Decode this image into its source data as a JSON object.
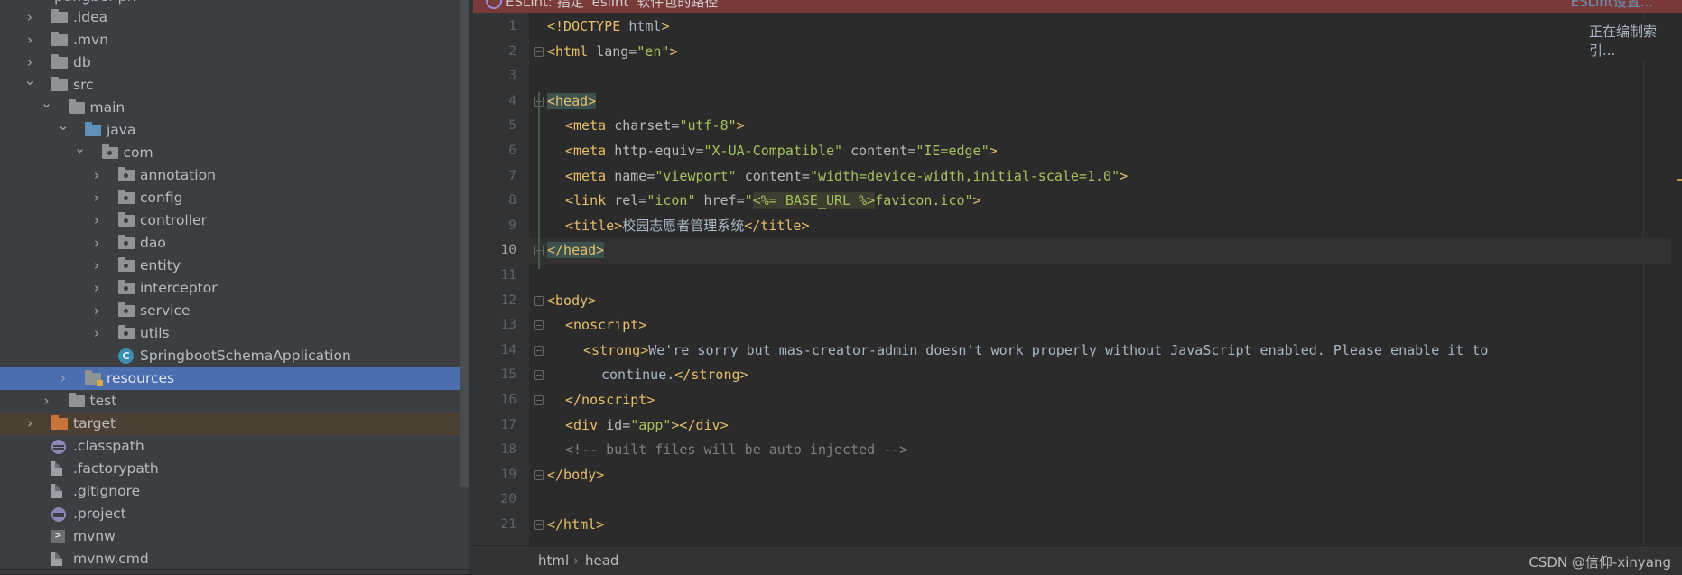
{
  "tree": {
    "top_clip": "pangbei-ph",
    "items": [
      {
        "label": ".idea",
        "depth": 1,
        "icon": "folder-icon",
        "expanded": false
      },
      {
        "label": ".mvn",
        "depth": 1,
        "icon": "folder-icon",
        "expanded": false
      },
      {
        "label": "db",
        "depth": 1,
        "icon": "folder-icon",
        "expanded": false
      },
      {
        "label": "src",
        "depth": 1,
        "icon": "folder-icon",
        "expanded": true
      },
      {
        "label": "main",
        "depth": 2,
        "icon": "folder-icon",
        "expanded": true
      },
      {
        "label": "java",
        "depth": 3,
        "icon": "source-folder-icon",
        "expanded": true
      },
      {
        "label": "com",
        "depth": 4,
        "icon": "package-icon",
        "expanded": true
      },
      {
        "label": "annotation",
        "depth": 5,
        "icon": "package-icon",
        "expanded": false
      },
      {
        "label": "config",
        "depth": 5,
        "icon": "package-icon",
        "expanded": false
      },
      {
        "label": "controller",
        "depth": 5,
        "icon": "package-icon",
        "expanded": false
      },
      {
        "label": "dao",
        "depth": 5,
        "icon": "package-icon",
        "expanded": false
      },
      {
        "label": "entity",
        "depth": 5,
        "icon": "package-icon",
        "expanded": false
      },
      {
        "label": "interceptor",
        "depth": 5,
        "icon": "package-icon",
        "expanded": false
      },
      {
        "label": "service",
        "depth": 5,
        "icon": "package-icon",
        "expanded": false
      },
      {
        "label": "utils",
        "depth": 5,
        "icon": "package-icon",
        "expanded": false
      },
      {
        "label": "SpringbootSchemaApplication",
        "depth": 5,
        "icon": "java-class-icon",
        "leaf": true
      },
      {
        "label": "resources",
        "depth": 3,
        "icon": "resources-folder-icon",
        "expanded": false,
        "selected": true
      },
      {
        "label": "test",
        "depth": 2,
        "icon": "folder-icon",
        "expanded": false
      },
      {
        "label": "target",
        "depth": 1,
        "icon": "excluded-folder-icon",
        "expanded": false,
        "excluded": true
      },
      {
        "label": ".classpath",
        "depth": 1,
        "icon": "eclipse-icon",
        "leaf": true
      },
      {
        "label": ".factorypath",
        "depth": 1,
        "icon": "file-icon",
        "leaf": true
      },
      {
        "label": ".gitignore",
        "depth": 1,
        "icon": "file-icon",
        "leaf": true
      },
      {
        "label": ".project",
        "depth": 1,
        "icon": "eclipse-icon",
        "leaf": true
      },
      {
        "label": "mvnw",
        "depth": 1,
        "icon": "terminal-file-icon",
        "leaf": true
      },
      {
        "label": "mvnw.cmd",
        "depth": 1,
        "icon": "file-icon",
        "leaf": true
      }
    ]
  },
  "banner": {
    "text": "ESLint: 指定 'eslint' 软件包的路径",
    "link": "ESLint设置..."
  },
  "indexing_status": "正在编制索引...",
  "editor": {
    "current_line": 10,
    "lines": [
      {
        "n": "1",
        "segs": [
          [
            "tag",
            "<!DOCTYPE "
          ],
          [
            "plain",
            "html"
          ],
          [
            "tag",
            ">"
          ]
        ]
      },
      {
        "n": "2",
        "fold": true,
        "segs": [
          [
            "tag",
            "<html "
          ],
          [
            "attr",
            "lang="
          ],
          [
            "val",
            "\"en\""
          ],
          [
            "tag",
            ">"
          ]
        ]
      },
      {
        "n": "3",
        "segs": []
      },
      {
        "n": "4",
        "fold": true,
        "segs": [
          [
            "taghl",
            "<head>"
          ]
        ]
      },
      {
        "n": "5",
        "ind": 1,
        "segs": [
          [
            "tag",
            "<meta "
          ],
          [
            "attr",
            "charset="
          ],
          [
            "val",
            "\"utf-8\""
          ],
          [
            "tag",
            ">"
          ]
        ]
      },
      {
        "n": "6",
        "ind": 1,
        "segs": [
          [
            "tag",
            "<meta "
          ],
          [
            "attr",
            "http-equiv="
          ],
          [
            "val",
            "\"X-UA-Compatible\" "
          ],
          [
            "attr",
            "content="
          ],
          [
            "val",
            "\"IE=edge\""
          ],
          [
            "tag",
            ">"
          ]
        ]
      },
      {
        "n": "7",
        "ind": 1,
        "segs": [
          [
            "tag",
            "<meta "
          ],
          [
            "attr",
            "name="
          ],
          [
            "val",
            "\"viewport\" "
          ],
          [
            "attr",
            "content="
          ],
          [
            "val",
            "\"width=device-width,initial-scale=1.0\""
          ],
          [
            "tag",
            ">"
          ]
        ]
      },
      {
        "n": "8",
        "ind": 1,
        "segs": [
          [
            "tag",
            "<link "
          ],
          [
            "attr",
            "rel="
          ],
          [
            "val",
            "\"icon\" "
          ],
          [
            "attr",
            "href="
          ],
          [
            "val",
            "\""
          ],
          [
            "tmpl",
            "<%= BASE_URL %>"
          ],
          [
            "val",
            "favicon.ico\""
          ],
          [
            "tag",
            ">"
          ]
        ]
      },
      {
        "n": "9",
        "ind": 1,
        "segs": [
          [
            "tag",
            "<title>"
          ],
          [
            "plain",
            "校园志愿者管理系统"
          ],
          [
            "tag",
            "</title>"
          ]
        ]
      },
      {
        "n": "10",
        "fold": true,
        "segs": [
          [
            "taghl",
            "</head>"
          ]
        ]
      },
      {
        "n": "11",
        "segs": []
      },
      {
        "n": "12",
        "fold": true,
        "segs": [
          [
            "tag",
            "<body>"
          ]
        ]
      },
      {
        "n": "13",
        "ind": 1,
        "fold": true,
        "segs": [
          [
            "tag",
            "<noscript>"
          ]
        ]
      },
      {
        "n": "14",
        "ind": 2,
        "fold": true,
        "segs": [
          [
            "tag",
            "<strong>"
          ],
          [
            "plain",
            "We're sorry but mas-creator-admin doesn't work properly without JavaScript enabled. Please enable it to"
          ]
        ]
      },
      {
        "n": "15",
        "ind": 3,
        "fold": true,
        "segs": [
          [
            "plain",
            "continue."
          ],
          [
            "tag",
            "</strong>"
          ]
        ]
      },
      {
        "n": "16",
        "ind": 1,
        "fold": true,
        "segs": [
          [
            "tag",
            "</noscript>"
          ]
        ]
      },
      {
        "n": "17",
        "ind": 1,
        "segs": [
          [
            "tag",
            "<div "
          ],
          [
            "attr",
            "id="
          ],
          [
            "val",
            "\"app\""
          ],
          [
            "tag",
            "></div>"
          ]
        ]
      },
      {
        "n": "18",
        "ind": 1,
        "segs": [
          [
            "cmt",
            "<!-- built files will be auto injected -->"
          ]
        ]
      },
      {
        "n": "19",
        "fold": true,
        "segs": [
          [
            "tag",
            "</body>"
          ]
        ]
      },
      {
        "n": "20",
        "segs": []
      },
      {
        "n": "21",
        "fold": true,
        "segs": [
          [
            "tag",
            "</html>"
          ]
        ]
      }
    ]
  },
  "breadcrumb": {
    "first": "html",
    "second": "head"
  },
  "watermark": "CSDN @信仰-xinyang",
  "colors": {
    "selection": "#4b6eaf",
    "banner": "#7a3a3a",
    "tag": "#e8bf6a",
    "value": "#a5c25c"
  }
}
